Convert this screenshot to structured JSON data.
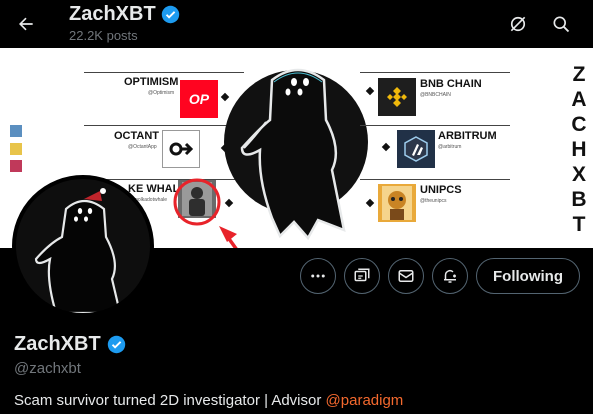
{
  "header": {
    "back_icon": "arrow-left-icon",
    "title": "ZachXBT",
    "posts": "22.2K posts",
    "verified_icon": "verified-badge-icon",
    "grok_icon": "grok-icon",
    "search_icon": "search-icon"
  },
  "banner": {
    "brand_vertical": [
      "Z",
      "A",
      "C",
      "H",
      "X",
      "B",
      "T"
    ],
    "left_items": [
      {
        "name": "OPTIMISM",
        "handle": "@Optimism",
        "logo_text": "OP",
        "logo_color": "#ff0420"
      },
      {
        "name": "OCTANT",
        "handle": "@OctantApp",
        "logo_text": "",
        "logo_color": "#ffffff"
      },
      {
        "name": "KE WHALE",
        "handle": "@polkadotwhale",
        "logo_text": "",
        "logo_color": "#7a7a7a"
      }
    ],
    "right_items": [
      {
        "name": "BNB CHAIN",
        "handle": "@BNBCHAIN",
        "logo_text": "",
        "logo_color": "#1e1e1e"
      },
      {
        "name": "ARBITRUM",
        "handle": "@arbitrum",
        "logo_text": "",
        "logo_color": "#213147"
      },
      {
        "name": "UNIPCS",
        "handle": "@theunipcs",
        "logo_text": "",
        "logo_color": "#e9a93a"
      }
    ],
    "swatches": [
      "#5b8fc0",
      "#e8c44a",
      "#c0395a"
    ],
    "annotation_color": "#e8232a"
  },
  "actions": {
    "more_icon": "more-dots-icon",
    "subscribe_icon": "subscribe-icon",
    "message_icon": "envelope-icon",
    "notify_icon": "bell-plus-icon",
    "follow_label": "Following"
  },
  "profile": {
    "name": "ZachXBT",
    "username": "@zachxbt",
    "bio_text": "Scam survivor turned 2D investigator | Advisor ",
    "bio_mention": "@paradigm",
    "mention_color": "#f4692e",
    "verified_color": "#1d9bf0"
  }
}
